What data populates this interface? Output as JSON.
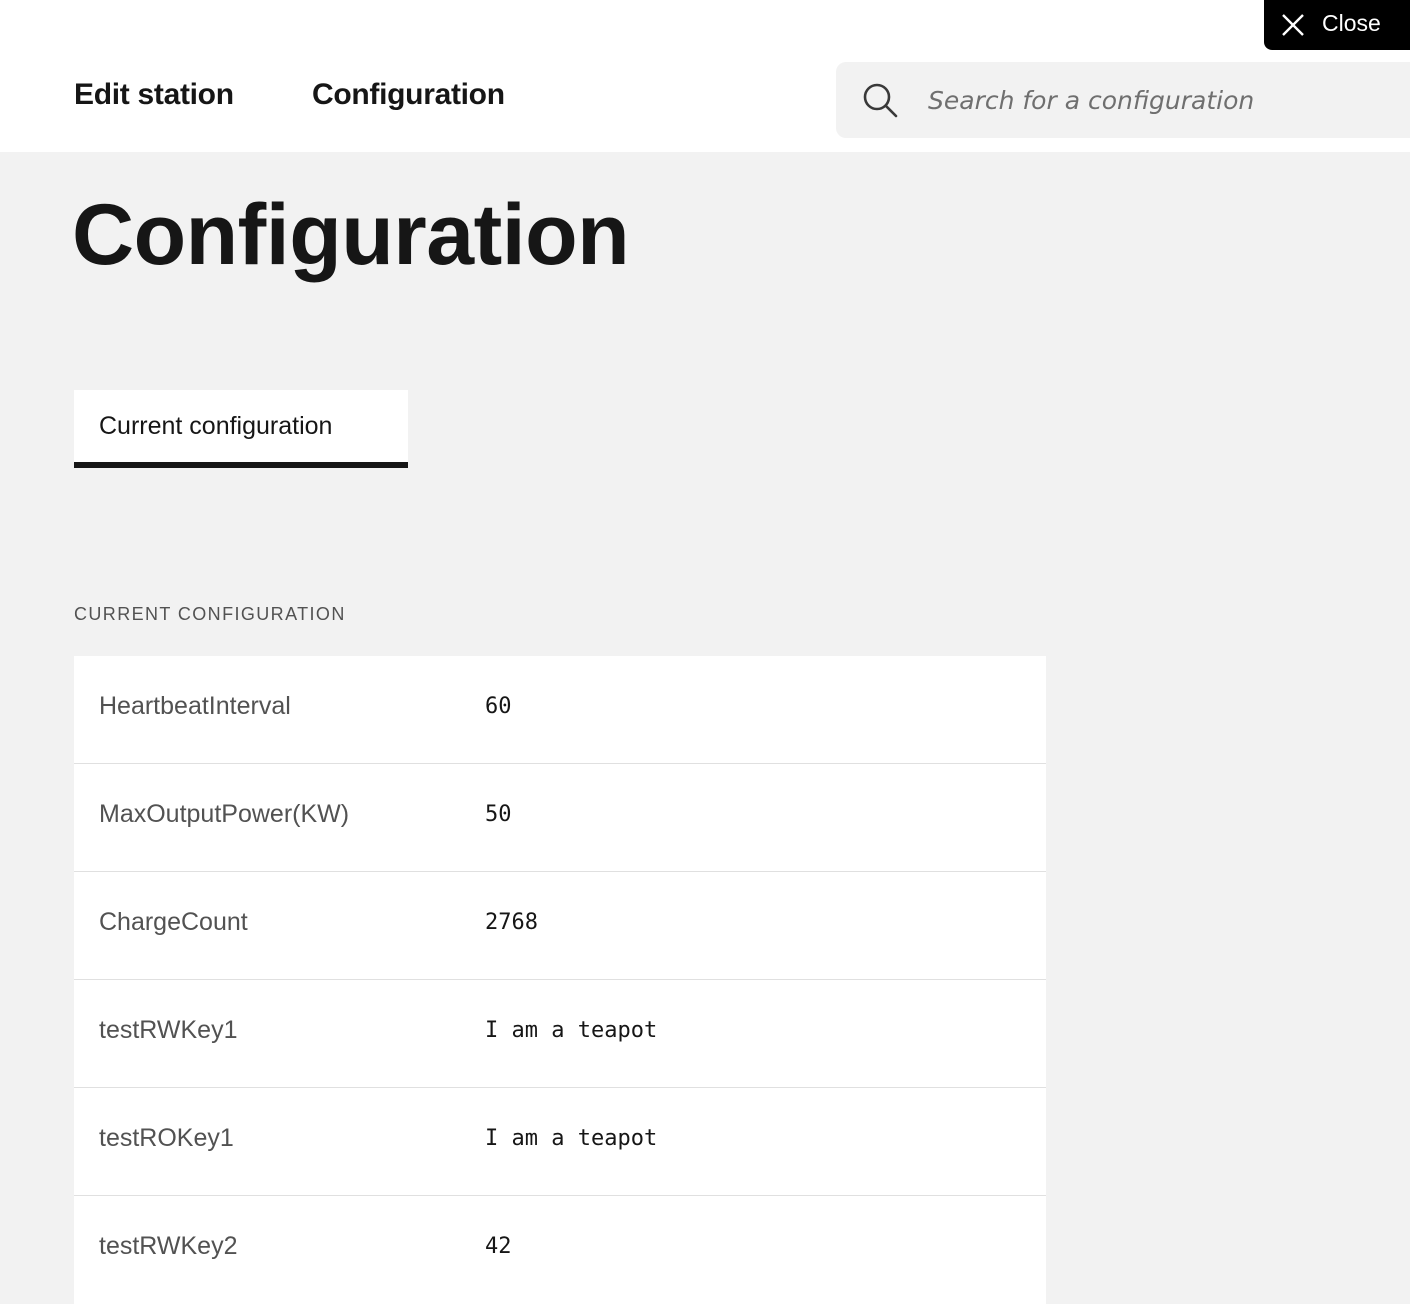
{
  "close": {
    "label": "Close"
  },
  "nav": {
    "edit_station": "Edit station",
    "configuration": "Configuration"
  },
  "search": {
    "placeholder": "Search for a configuration",
    "value": ""
  },
  "page": {
    "title": "Configuration"
  },
  "tabs": [
    {
      "label": "Current configuration",
      "selected": true
    }
  ],
  "section": {
    "heading": "CURRENT CONFIGURATION"
  },
  "config": {
    "rows": [
      {
        "key": "HeartbeatInterval",
        "value": "60"
      },
      {
        "key": "MaxOutputPower(KW)",
        "value": "50"
      },
      {
        "key": "ChargeCount",
        "value": "2768"
      },
      {
        "key": "testRWKey1",
        "value": "I am a teapot"
      },
      {
        "key": "testROKey1",
        "value": "I am a teapot"
      },
      {
        "key": "testRWKey2",
        "value": "42"
      }
    ]
  },
  "colors": {
    "page_background": "#f2f2f2",
    "surface": "#ffffff",
    "text_primary": "#161616",
    "text_secondary": "#525252",
    "close_background": "#000000"
  },
  "icons": {
    "search": "search-icon",
    "close": "close-icon"
  }
}
